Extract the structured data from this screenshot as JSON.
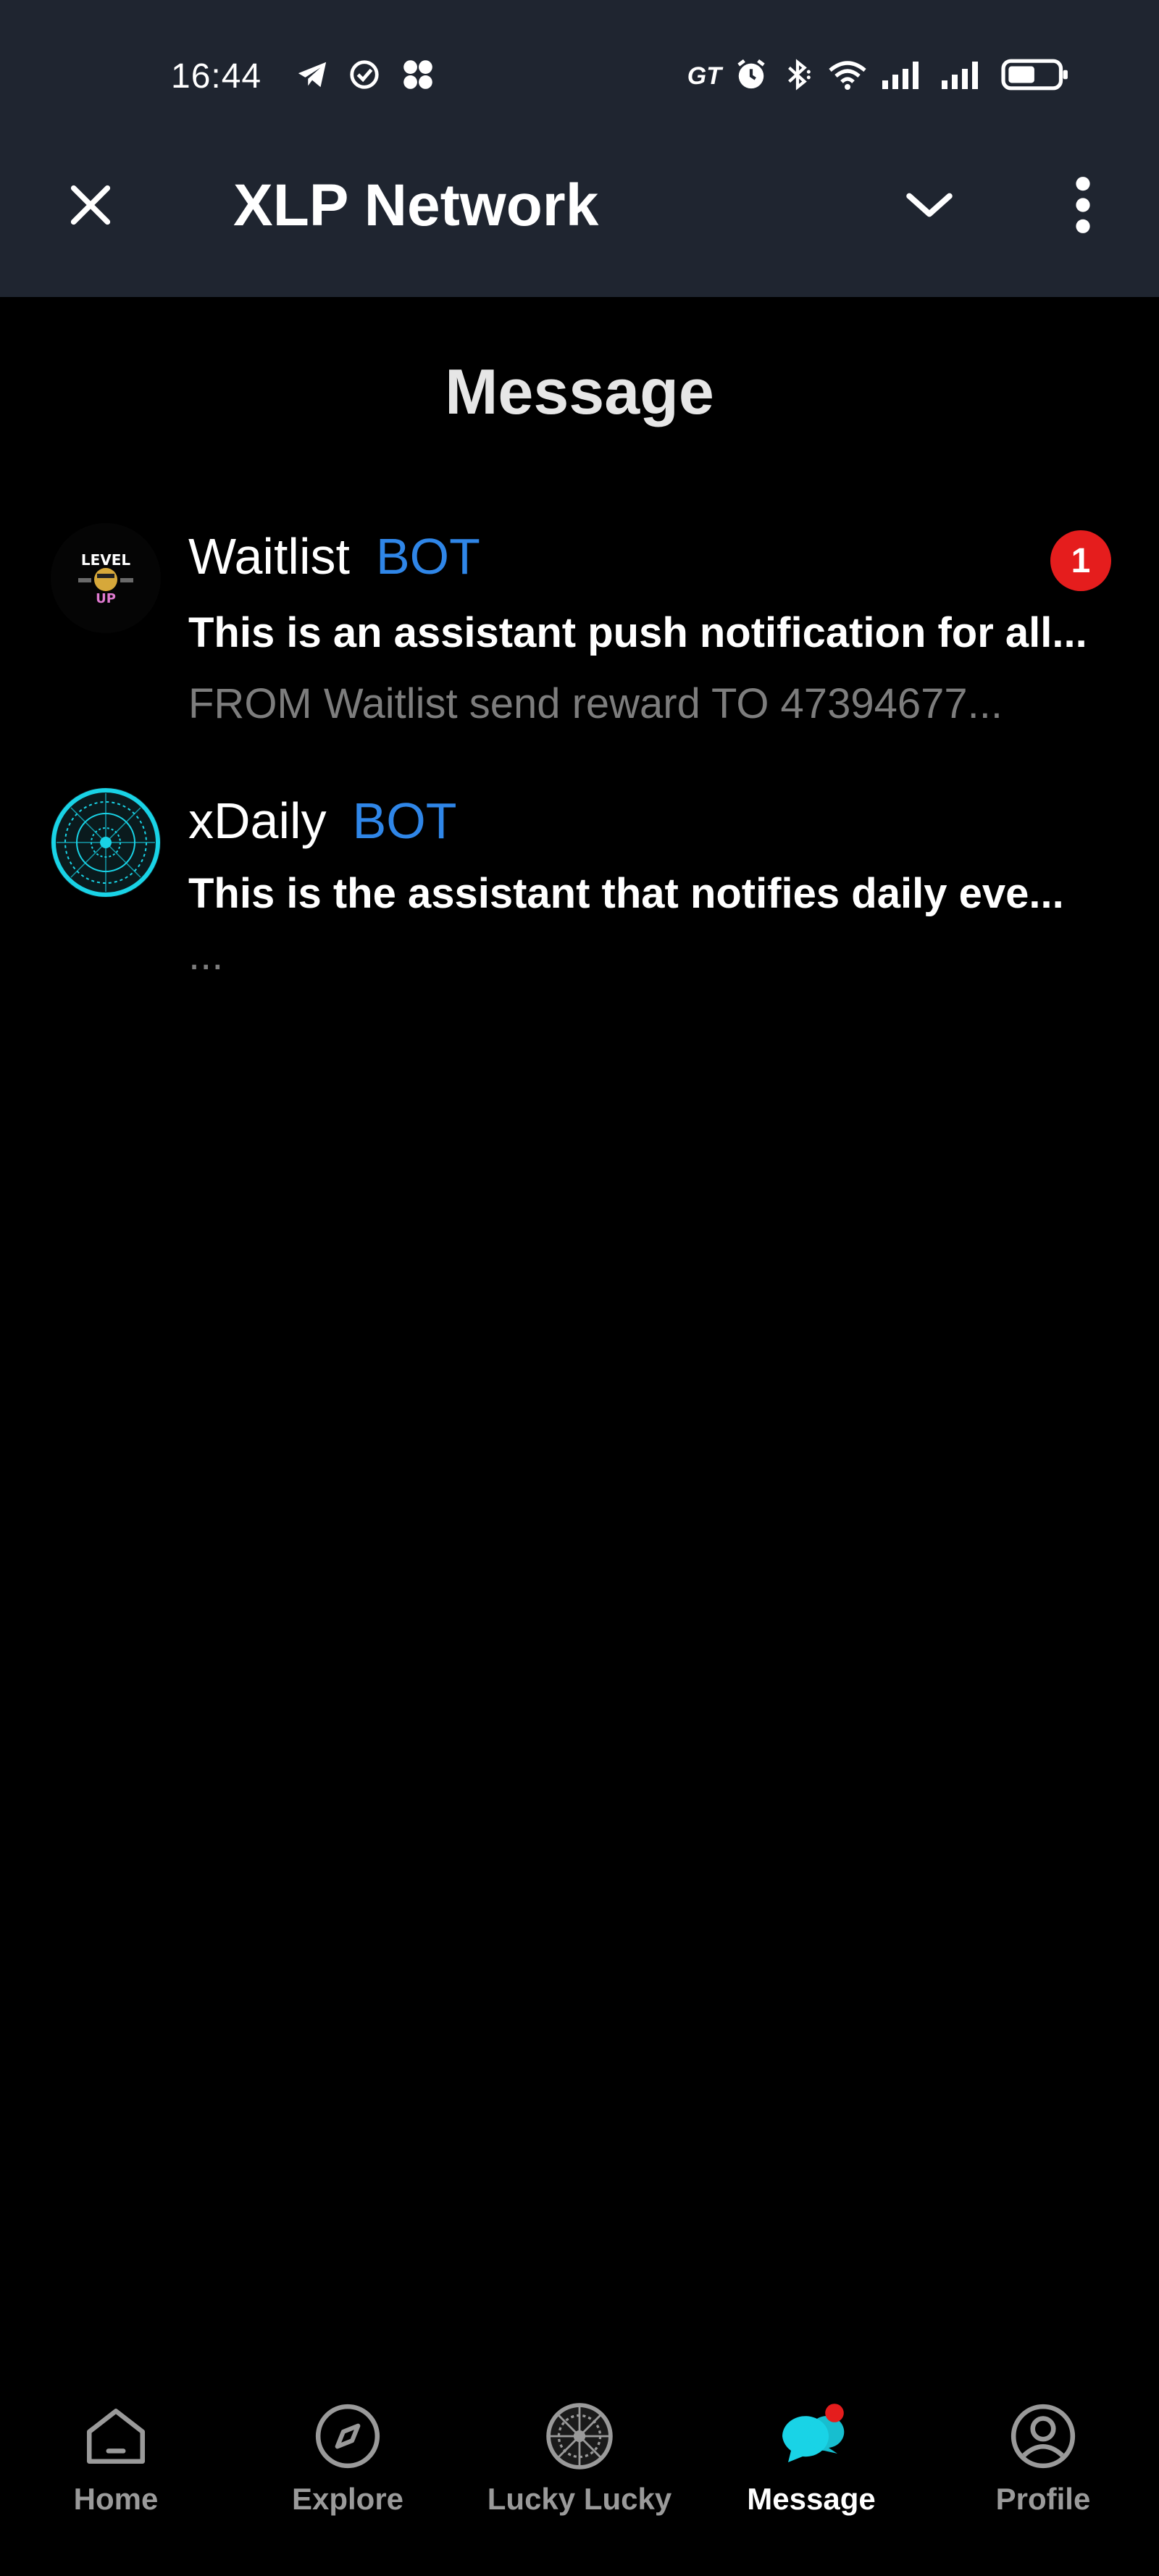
{
  "status_bar": {
    "time": "16:44",
    "left_icons": [
      "telegram-icon",
      "check-circle-icon",
      "apps-icon"
    ],
    "right_icons": [
      "gt-icon",
      "alarm-icon",
      "bluetooth-icon",
      "wifi-icon",
      "signal-icon",
      "signal-icon",
      "battery-icon"
    ],
    "gt_text": "GT"
  },
  "header": {
    "title": "XLP Network",
    "close_icon": "close-icon",
    "collapse_icon": "chevron-down-icon",
    "menu_icon": "more-vertical-icon"
  },
  "page": {
    "title": "Message"
  },
  "messages": [
    {
      "name": "Waitlist",
      "tag": "BOT",
      "preview": "This is an assistant push notification for all...",
      "subtext": "FROM Waitlist send reward TO 47394677...",
      "unread": "1",
      "avatar_text_top": "LEVEL",
      "avatar_text_bottom": "UP"
    },
    {
      "name": "xDaily",
      "tag": "BOT",
      "preview": "This is the assistant that notifies daily eve...",
      "subtext": "..."
    }
  ],
  "nav": [
    {
      "label": "Home",
      "icon": "home-icon"
    },
    {
      "label": "Explore",
      "icon": "compass-icon"
    },
    {
      "label": "Lucky Lucky",
      "icon": "wheel-icon"
    },
    {
      "label": "Message",
      "icon": "chat-icon",
      "active": true
    },
    {
      "label": "Profile",
      "icon": "user-icon"
    }
  ],
  "colors": {
    "header_bg": "#1f2530",
    "background": "#000000",
    "bot_tag": "#2f86e8",
    "badge": "#e51d1d",
    "active_accent": "#19d3e6"
  }
}
